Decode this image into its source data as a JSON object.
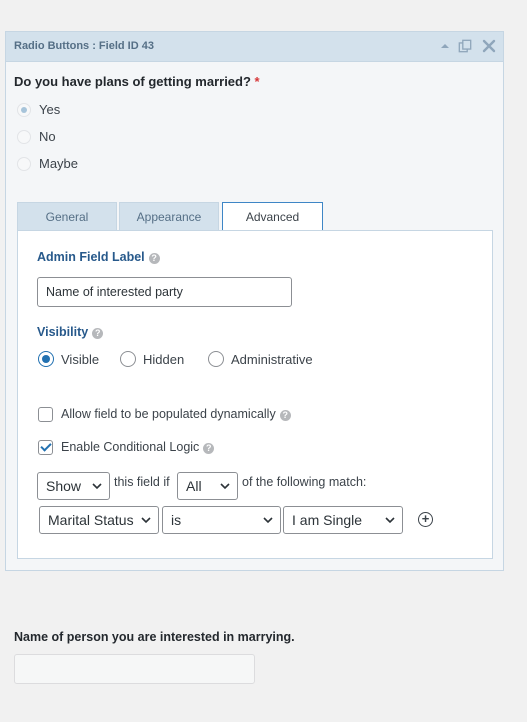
{
  "field": {
    "title": "Radio Buttons : Field ID 43",
    "question": "Do you have plans of getting married?",
    "required_mark": "*",
    "options": [
      "Yes",
      "No",
      "Maybe"
    ],
    "selected_option": "Yes"
  },
  "header_icons": [
    "collapse-icon",
    "duplicate-icon",
    "delete-icon"
  ],
  "tabs": [
    {
      "label": "General",
      "active": false
    },
    {
      "label": "Appearance",
      "active": false
    },
    {
      "label": "Advanced",
      "active": true
    }
  ],
  "advanced": {
    "admin_label_title": "Admin Field Label",
    "admin_label_value": "Name of interested party",
    "visibility_title": "Visibility",
    "visibility_options": [
      "Visible",
      "Hidden",
      "Administrative"
    ],
    "visibility_selected": "Visible",
    "allow_dynamic_label": "Allow field to be populated dynamically",
    "allow_dynamic_checked": false,
    "conditional_logic_label": "Enable Conditional Logic",
    "conditional_logic_checked": true,
    "logic": {
      "action": "Show",
      "text_this_field_if": "this field if",
      "match": "All",
      "text_of_following": "of the following match:",
      "rule_field": "Marital Status",
      "rule_operator": "is",
      "rule_value": "I am Single"
    }
  },
  "next_field": {
    "label": "Name of person you are interested in marrying.",
    "value": ""
  },
  "colors": {
    "header_bg": "#d3e1ec",
    "label_blue": "#27598b",
    "accent": "#2271b1",
    "required": "#d63638"
  }
}
